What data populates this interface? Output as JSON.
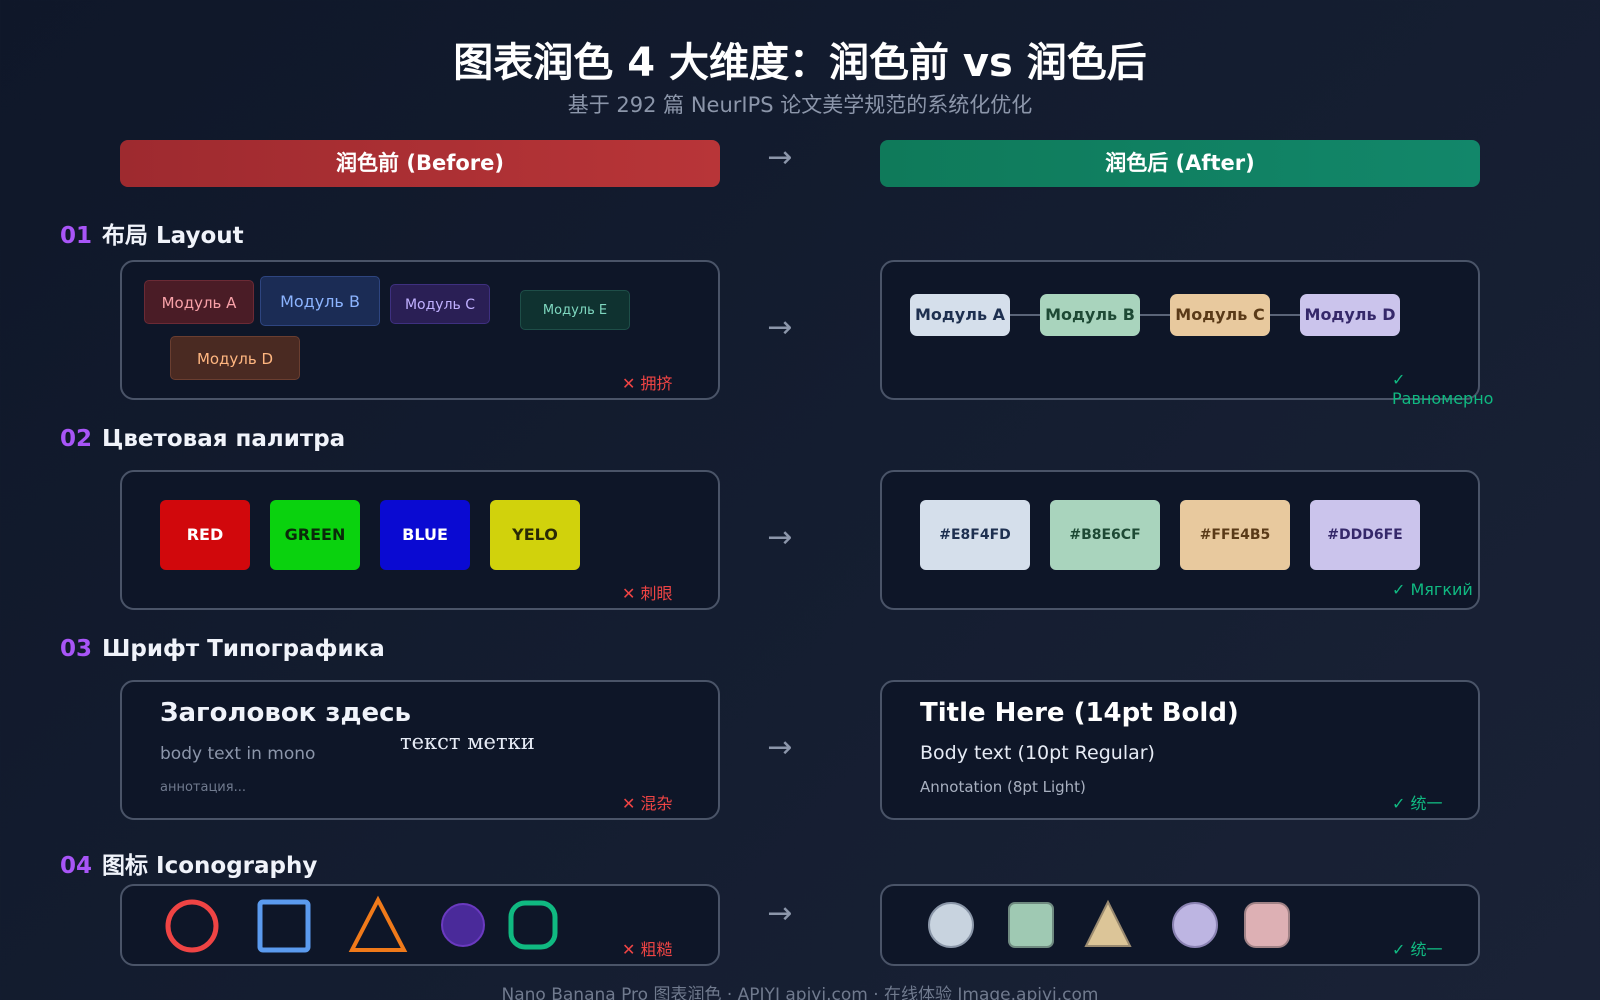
{
  "title": "图表润色 4 大维度：润色前 vs 润色后",
  "subtitle": "基于 292 篇 NeurIPS 论文美学规范的系统化优化",
  "header": {
    "before": "润色前 (Before)",
    "after": "润色后 (After)",
    "arrow": "→"
  },
  "sections": [
    {
      "num": "01",
      "label": "布局 Layout",
      "before_modules": [
        "Модуль A",
        "Модуль B",
        "Модуль C",
        "Модуль E",
        "Модуль D"
      ],
      "after_modules": [
        "Модуль A",
        "Модуль B",
        "Модуль C",
        "Модуль D"
      ],
      "before_verdict": "✕ 拥挤",
      "after_verdict": "✓ Равномерно"
    },
    {
      "num": "02",
      "label": "Цветовая палитра",
      "before_swatches": [
        "RED",
        "GREEN",
        "BLUE",
        "YELO"
      ],
      "after_swatches": [
        "#E8F4FD",
        "#B8E6CF",
        "#FFE4B5",
        "#DDD6FE"
      ],
      "before_verdict": "✕ 刺眼",
      "after_verdict": "✓ Мягкий"
    },
    {
      "num": "03",
      "label": "Шрифт Типографика",
      "before_heading": "Заголовок здесь",
      "before_body": "body text in mono",
      "before_label": "текст метки",
      "before_annotation": "аннотация...",
      "after_heading": "Title Here (14pt Bold)",
      "after_body": "Body text (10pt Regular)",
      "after_annotation": "Annotation (8pt Light)",
      "before_verdict": "✕ 混杂",
      "after_verdict": "✓ 统一"
    },
    {
      "num": "04",
      "label": "图标 Iconography",
      "before_verdict": "✕ 粗糙",
      "after_verdict": "✓ 统一"
    }
  ],
  "colors": {
    "before_header": "#b83538",
    "after_header": "#12876a",
    "bad": "#ef4444",
    "good": "#10b981",
    "accent": "#a855f7"
  },
  "footer": "Nano Banana Pro 图表润色 · APIYI apiyi.com · 在线体验 Image.apiyi.com"
}
